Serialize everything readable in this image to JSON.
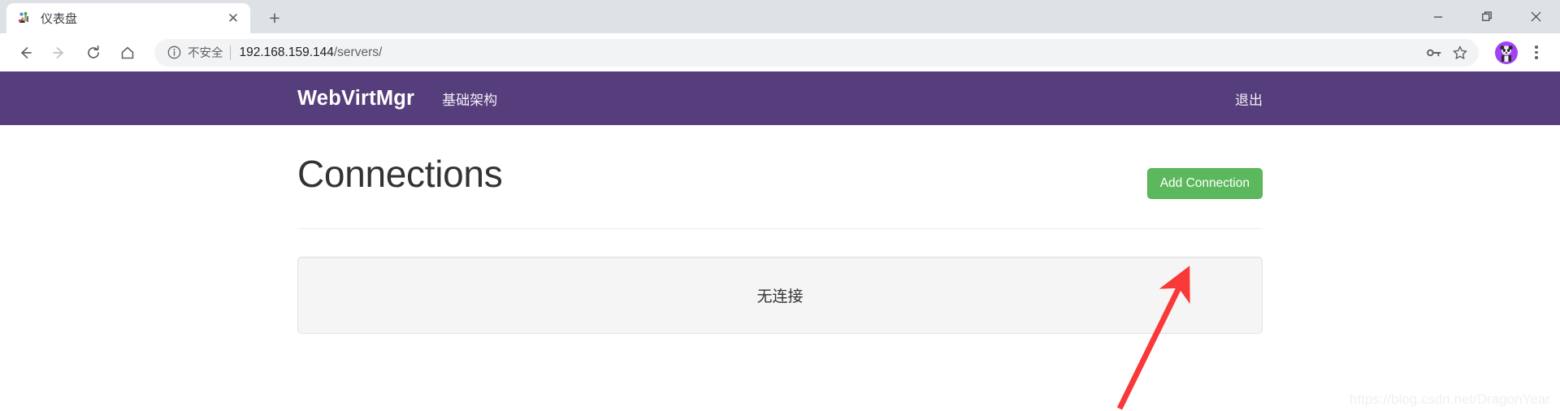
{
  "browser": {
    "tab": {
      "title": "仪表盘",
      "favicon_name": "dashboard-favicon",
      "close_label": "✕"
    },
    "new_tab_label": "+",
    "window_controls": {
      "minimize": "minimize",
      "restore": "restore",
      "close": "close"
    },
    "toolbar": {
      "back_label": "←",
      "forward_label": "→",
      "reload_label": "⟳",
      "home_label": "⌂",
      "security_label": "不安全",
      "url_host": "192.168.159.144",
      "url_path": "/servers/",
      "password_icon": "key-icon",
      "bookmark_icon": "star-icon",
      "profile_icon": "avatar",
      "menu_icon": "three-dot-menu"
    }
  },
  "app": {
    "navbar": {
      "brand": "WebVirtMgr",
      "links": [
        {
          "label": "基础架构"
        }
      ],
      "logout_label": "退出",
      "background_color": "#563d7c"
    },
    "main": {
      "title": "Connections",
      "add_button_label": "Add Connection",
      "add_button_color": "#5cb85c",
      "empty_panel_text": "无连接"
    },
    "annotation": {
      "arrow_color": "#f93838",
      "arrow_name": "red-pointer-arrow"
    },
    "watermark": "https://blog.csdn.net/DragonYear"
  }
}
